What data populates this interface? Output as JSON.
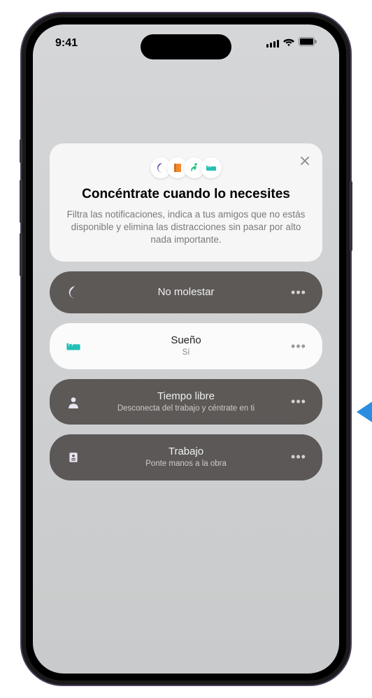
{
  "status": {
    "time": "9:41"
  },
  "intro": {
    "title": "Concéntrate cuando lo necesites",
    "text": "Filtra las notificaciones, indica a tus amigos que no estás disponible y elimina las distracciones sin pasar por alto nada importante."
  },
  "colors": {
    "moon": "#6a5ea8",
    "book": "#f28a2f",
    "run": "#2bc28a",
    "bed": "#22c0b7"
  },
  "modes": [
    {
      "title": "No molestar",
      "sub": "",
      "icon": "moon",
      "active": false
    },
    {
      "title": "Sueño",
      "sub": "Sí",
      "icon": "bed",
      "active": true
    },
    {
      "title": "Tiempo libre",
      "sub": "Desconecta del trabajo y céntrate en ti",
      "icon": "person",
      "active": false
    },
    {
      "title": "Trabajo",
      "sub": "Ponte manos a la obra",
      "icon": "badge",
      "active": false
    }
  ]
}
